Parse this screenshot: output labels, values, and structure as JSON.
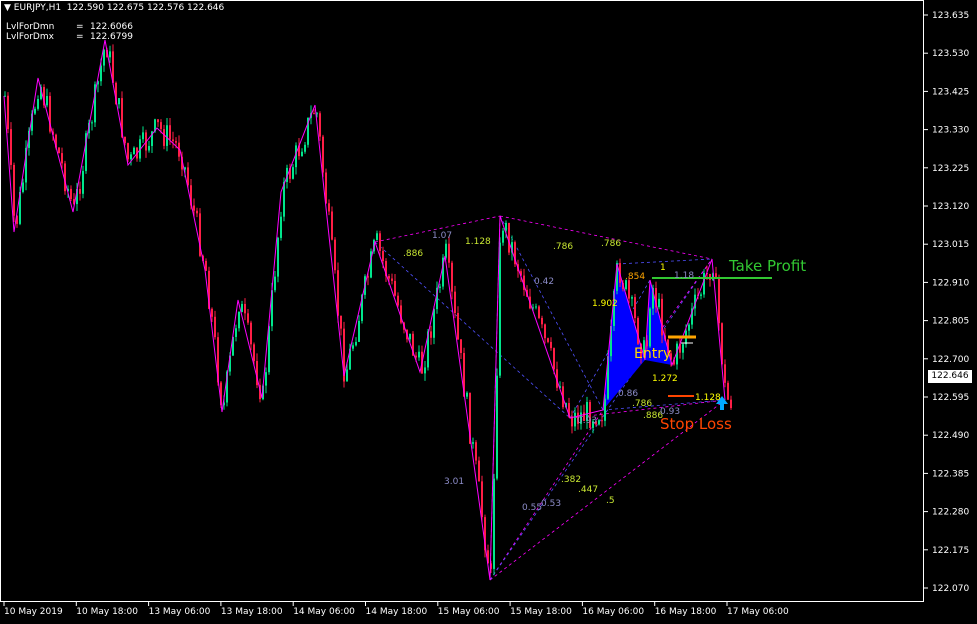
{
  "header": {
    "symbol": "EURJPY,H1",
    "ohlc": "122.590 122.675 122.576 122.646"
  },
  "indicators": [
    {
      "name": "LvlForDmn",
      "value": "122.6066"
    },
    {
      "name": "LvlForDmx",
      "value": "122.6799"
    }
  ],
  "current_price": "122.646",
  "price_axis": [
    "123.635",
    "123.530",
    "123.425",
    "123.330",
    "123.225",
    "123.120",
    "123.015",
    "122.910",
    "122.805",
    "122.700",
    "122.595",
    "122.490",
    "122.385",
    "122.280",
    "122.175",
    "122.070"
  ],
  "time_axis": [
    "10 May 2019",
    "10 May 18:00",
    "13 May 06:00",
    "13 May 18:00",
    "14 May 06:00",
    "14 May 18:00",
    "15 May 06:00",
    "15 May 18:00",
    "16 May 06:00",
    "16 May 18:00",
    "17 May 06:00"
  ],
  "labels": {
    "take_profit": "Take Profit",
    "entry": "Entry",
    "stop_loss": "Stop Loss"
  },
  "fib_levels": [
    {
      "text": "1.07",
      "color": "#8c8cc8"
    },
    {
      "text": "1.128",
      "color": "#c8e632"
    },
    {
      "text": ".886",
      "color": "#c8e632"
    },
    {
      "text": ".786",
      "color": "#c8e632"
    },
    {
      "text": ".786",
      "color": "#c8e632"
    },
    {
      "text": "0.42",
      "color": "#8c8cc8"
    },
    {
      "text": "1",
      "color": "#ffff00"
    },
    {
      "text": "1.18",
      "color": "#8c8cc8"
    },
    {
      "text": ".854",
      "color": "#ffa500"
    },
    {
      "text": "1.902",
      "color": "#ffff00"
    },
    {
      "text": "1.272",
      "color": "#ffff00"
    },
    {
      "text": "0.86",
      "color": "#8c8cc8"
    },
    {
      "text": ".786",
      "color": "#c8e632"
    },
    {
      "text": ".886",
      "color": "#c8e632"
    },
    {
      "text": "0.93",
      "color": "#8c8cc8"
    },
    {
      "text": "1.128",
      "color": "#ffff00"
    },
    {
      "text": "0.93",
      "color": "#8c8cc8"
    },
    {
      "text": "3.01",
      "color": "#8c8cc8"
    },
    {
      "text": ".382",
      "color": "#c8e632"
    },
    {
      "text": ".447",
      "color": "#c8e632"
    },
    {
      "text": "0.55",
      "color": "#8c8cc8"
    },
    {
      "text": "0.53",
      "color": "#8c8cc8"
    },
    {
      "text": ".5",
      "color": "#c8e632"
    }
  ],
  "colors": {
    "bull": "#00e68c",
    "bear": "#ff1e46",
    "zigzag": "#ff00ff",
    "pattern_fill": "#0000ff",
    "take_profit": "#32c832",
    "entry_label": "#ffd800",
    "entry_line": "#ffa500",
    "stop_loss": "#ff4500",
    "arrow": "#00aaff"
  }
}
